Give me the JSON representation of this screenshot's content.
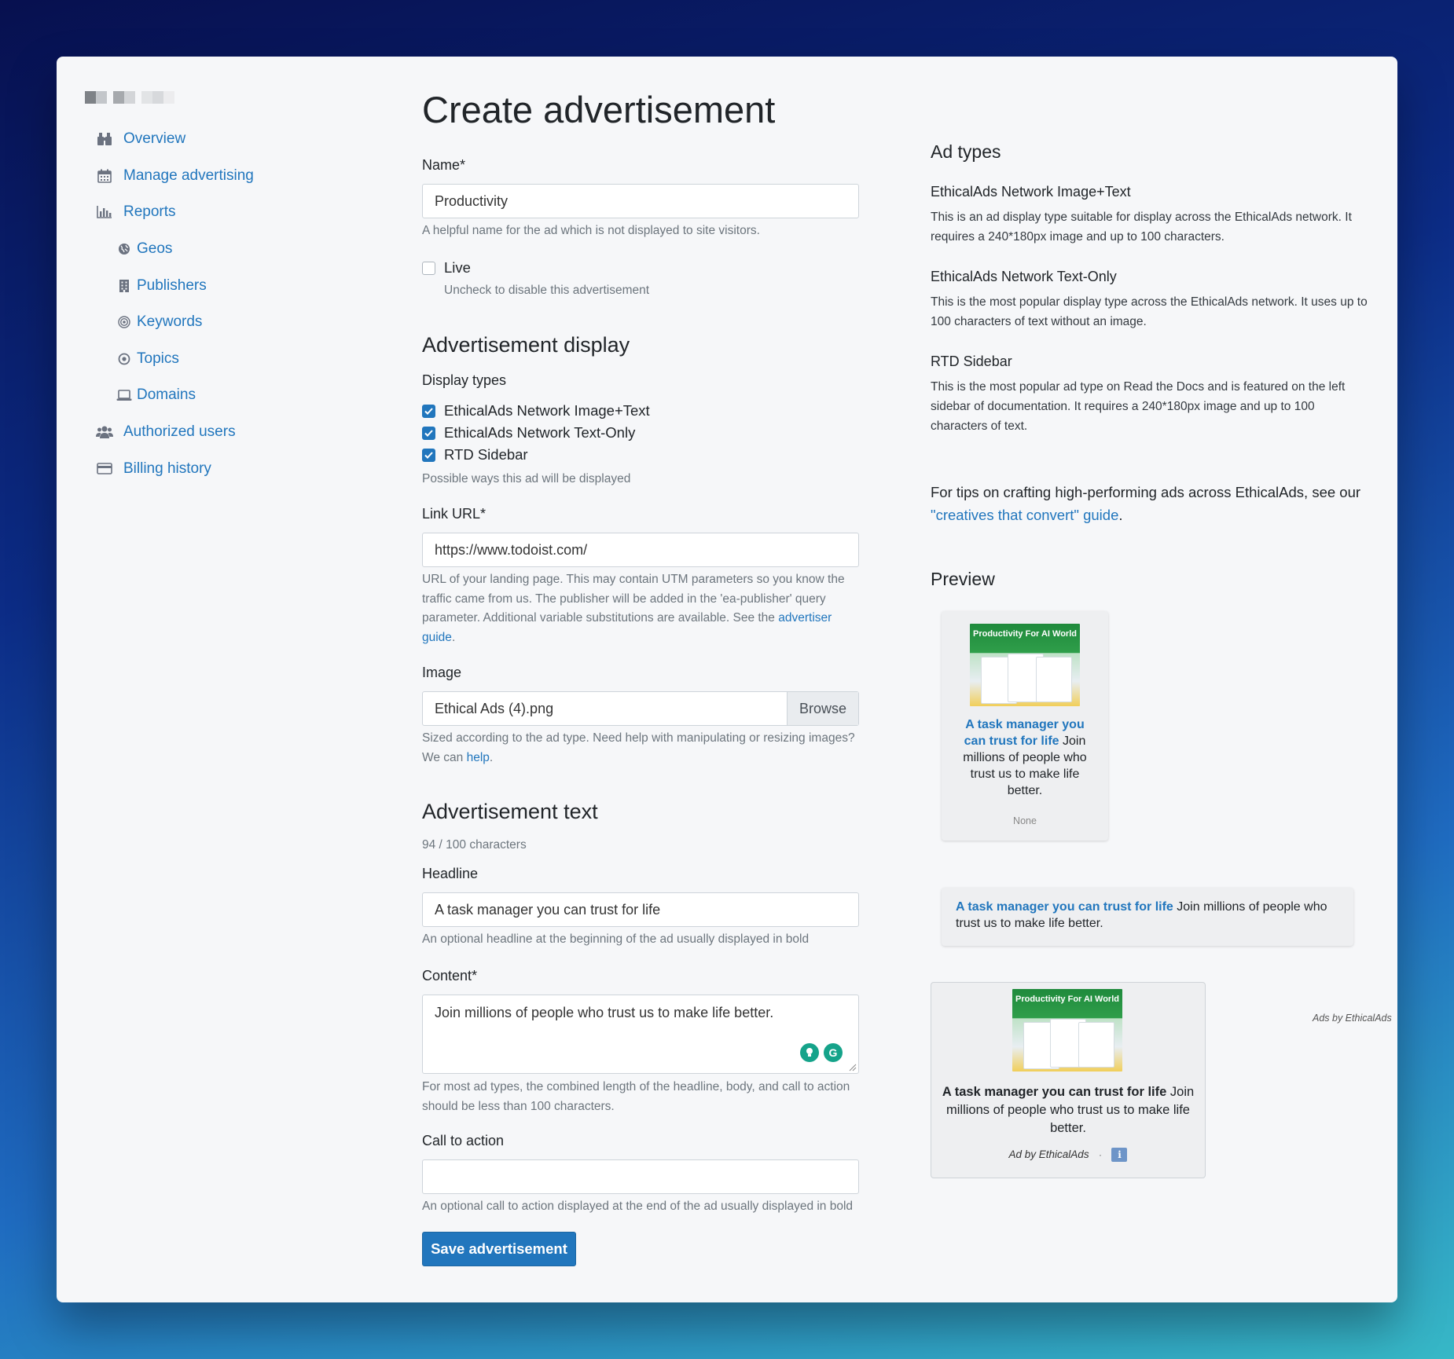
{
  "sidebar": {
    "items": [
      {
        "label": "Overview",
        "icon": "binoculars-icon"
      },
      {
        "label": "Manage advertising",
        "icon": "calendar-icon"
      },
      {
        "label": "Reports",
        "icon": "bar-chart-icon"
      },
      {
        "label": "Geos",
        "icon": "globe-icon"
      },
      {
        "label": "Publishers",
        "icon": "building-icon"
      },
      {
        "label": "Keywords",
        "icon": "target-icon"
      },
      {
        "label": "Topics",
        "icon": "dot-circle-icon"
      },
      {
        "label": "Domains",
        "icon": "laptop-icon"
      },
      {
        "label": "Authorized users",
        "icon": "users-icon"
      },
      {
        "label": "Billing history",
        "icon": "credit-card-icon"
      }
    ]
  },
  "form": {
    "title": "Create advertisement",
    "name": {
      "label": "Name*",
      "value": "Productivity",
      "help": "A helpful name for the ad which is not displayed to site visitors."
    },
    "live": {
      "label": "Live",
      "checked": false,
      "help": "Uncheck to disable this advertisement"
    },
    "display_section": "Advertisement display",
    "display_types": {
      "label": "Display types",
      "options": [
        {
          "label": "EthicalAds Network Image+Text",
          "checked": true
        },
        {
          "label": "EthicalAds Network Text-Only",
          "checked": true
        },
        {
          "label": "RTD Sidebar",
          "checked": true
        }
      ],
      "help": "Possible ways this ad will be displayed"
    },
    "link_url": {
      "label": "Link URL*",
      "value": "https://www.todoist.com/",
      "help": "URL of your landing page. This may contain UTM parameters so you know the traffic came from us. The publisher will be added in the 'ea-publisher' query parameter. Additional variable substitutions are available. See the",
      "help_link": "advertiser guide",
      "help_end": "."
    },
    "image": {
      "label": "Image",
      "value": "Ethical Ads (4).png",
      "browse": "Browse",
      "help": "Sized according to the ad type. Need help with manipulating or resizing images? We can",
      "help_link": "help",
      "help_end": "."
    },
    "text_section": "Advertisement text",
    "char_count": "94 / 100 characters",
    "headline": {
      "label": "Headline",
      "value": "A task manager you can trust for life",
      "help": "An optional headline at the beginning of the ad usually displayed in bold"
    },
    "content": {
      "label": "Content*",
      "value": "Join millions of people who trust us to make life better.",
      "help": "For most ad types, the combined length of the headline, body, and call to action should be less than 100 characters."
    },
    "cta": {
      "label": "Call to action",
      "value": "",
      "help": "An optional call to action displayed at the end of the ad usually displayed in bold"
    },
    "save": "Save advertisement"
  },
  "ad_types": {
    "title": "Ad types",
    "items": [
      {
        "name": "EthicalAds Network Image+Text",
        "desc": "This is an ad display type suitable for display across the EthicalAds network. It requires a 240*180px image and up to 100 characters."
      },
      {
        "name": "EthicalAds Network Text-Only",
        "desc": "This is the most popular display type across the EthicalAds network. It uses up to 100 characters of text without an image."
      },
      {
        "name": "RTD Sidebar",
        "desc": "This is the most popular ad type on Read the Docs and is featured on the left sidebar of documentation. It requires a 240*180px image and up to 100 characters of text."
      }
    ],
    "tip_pre": "For tips on crafting high-performing ads across EthicalAds, see our",
    "tip_link": "\"creatives that convert\" guide",
    "tip_end": "."
  },
  "preview": {
    "title": "Preview",
    "image_text": "Productivity For AI World",
    "headline": "A task manager you can trust for life",
    "body": "Join millions of people who trust us to make life better.",
    "cta_placeholder": "None",
    "ads_by": "Ads by EthicalAds",
    "ad_by": "Ad by EthicalAds",
    "separator": "·",
    "info": "i"
  },
  "colors": {
    "accent": "#2176bd",
    "background": "#f6f7f9"
  }
}
